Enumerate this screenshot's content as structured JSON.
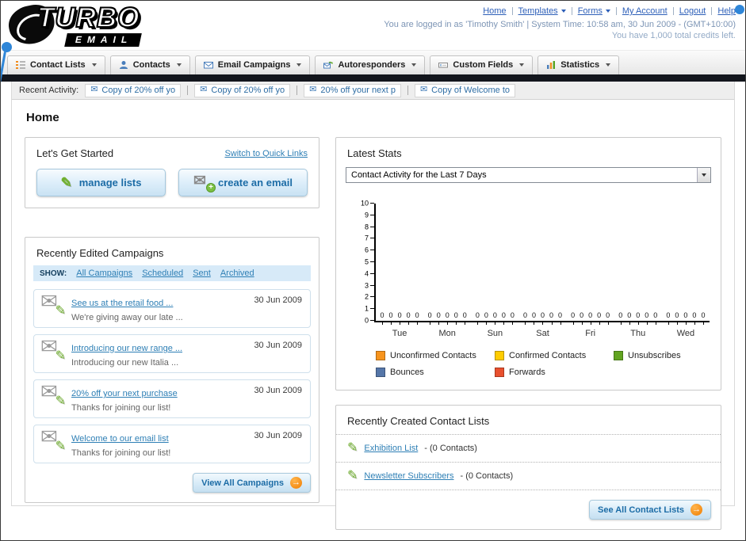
{
  "icons": {
    "envelope": "✉",
    "pencil": "✎",
    "plus": "+",
    "arrow_right": "→"
  },
  "header": {
    "logo_line1": "TURBO",
    "logo_line2": "EMAIL",
    "nav_links": [
      {
        "label": "Home"
      },
      {
        "label": "Templates"
      },
      {
        "label": "Forms"
      },
      {
        "label": "My Account"
      },
      {
        "label": "Logout"
      },
      {
        "label": "Help"
      }
    ],
    "login_info": "You are logged in as 'Timothy Smith' | System Time: 10:58 am, 30 Jun 2009 - (GMT+10:00)",
    "credits_info": "You have 1,000 total credits left."
  },
  "nav_tabs": [
    {
      "label": "Contact Lists"
    },
    {
      "label": "Contacts"
    },
    {
      "label": "Email Campaigns"
    },
    {
      "label": "Autoresponders"
    },
    {
      "label": "Custom Fields"
    },
    {
      "label": "Statistics"
    }
  ],
  "recent_activity": {
    "label": "Recent Activity:",
    "items": [
      "Copy of 20% off yo",
      "Copy of 20% off yo",
      "20% off your next p",
      "Copy of Welcome to"
    ]
  },
  "page_title": "Home",
  "get_started": {
    "title": "Let's Get Started",
    "switch_link": "Switch to Quick Links",
    "manage_lists_label": "manage lists",
    "create_email_label": "create an email"
  },
  "campaigns": {
    "title": "Recently Edited Campaigns",
    "show_label": "SHOW:",
    "filters": [
      "All Campaigns",
      "Scheduled",
      "Sent",
      "Archived"
    ],
    "items": [
      {
        "title": "See us at the retail food ...",
        "subtitle": "We're giving away our late ...",
        "date": "30 Jun 2009"
      },
      {
        "title": "Introducing our new range ...",
        "subtitle": "Introducing our new Italia ...",
        "date": "30 Jun 2009"
      },
      {
        "title": "20% off your next purchase",
        "subtitle": "Thanks for joining our list!",
        "date": "30 Jun 2009"
      },
      {
        "title": "Welcome to our email list",
        "subtitle": "Thanks for joining our list!",
        "date": "30 Jun 2009"
      }
    ],
    "view_all_label": "View All Campaigns"
  },
  "stats": {
    "title": "Latest Stats",
    "dropdown_value": "Contact Activity for the Last 7 Days",
    "chart_data": {
      "type": "bar",
      "title": "Contact Activity for the Last 7 Days",
      "categories": [
        "Tue",
        "Mon",
        "Sun",
        "Sat",
        "Fri",
        "Thu",
        "Wed"
      ],
      "series": [
        {
          "name": "Unconfirmed Contacts",
          "color": "#f7941d",
          "values": [
            0,
            0,
            0,
            0,
            0,
            0,
            0
          ]
        },
        {
          "name": "Confirmed Contacts",
          "color": "#ffcc00",
          "values": [
            0,
            0,
            0,
            0,
            0,
            0,
            0
          ]
        },
        {
          "name": "Unsubscribes",
          "color": "#62a420",
          "values": [
            0,
            0,
            0,
            0,
            0,
            0,
            0
          ]
        },
        {
          "name": "Bounces",
          "color": "#5576a8",
          "values": [
            0,
            0,
            0,
            0,
            0,
            0,
            0
          ]
        },
        {
          "name": "Forwards",
          "color": "#e8502e",
          "values": [
            0,
            0,
            0,
            0,
            0,
            0,
            0
          ]
        }
      ],
      "ylim": [
        0,
        10
      ],
      "xlabel": "",
      "ylabel": "",
      "grid": false,
      "legend_position": "bottom"
    }
  },
  "contact_lists": {
    "title": "Recently Created Contact Lists",
    "items": [
      {
        "name": "Exhibition List",
        "meta": "- (0 Contacts)"
      },
      {
        "name": "Newsletter Subscribers",
        "meta": "- (0 Contacts)"
      }
    ],
    "see_all_label": "See All Contact Lists"
  }
}
